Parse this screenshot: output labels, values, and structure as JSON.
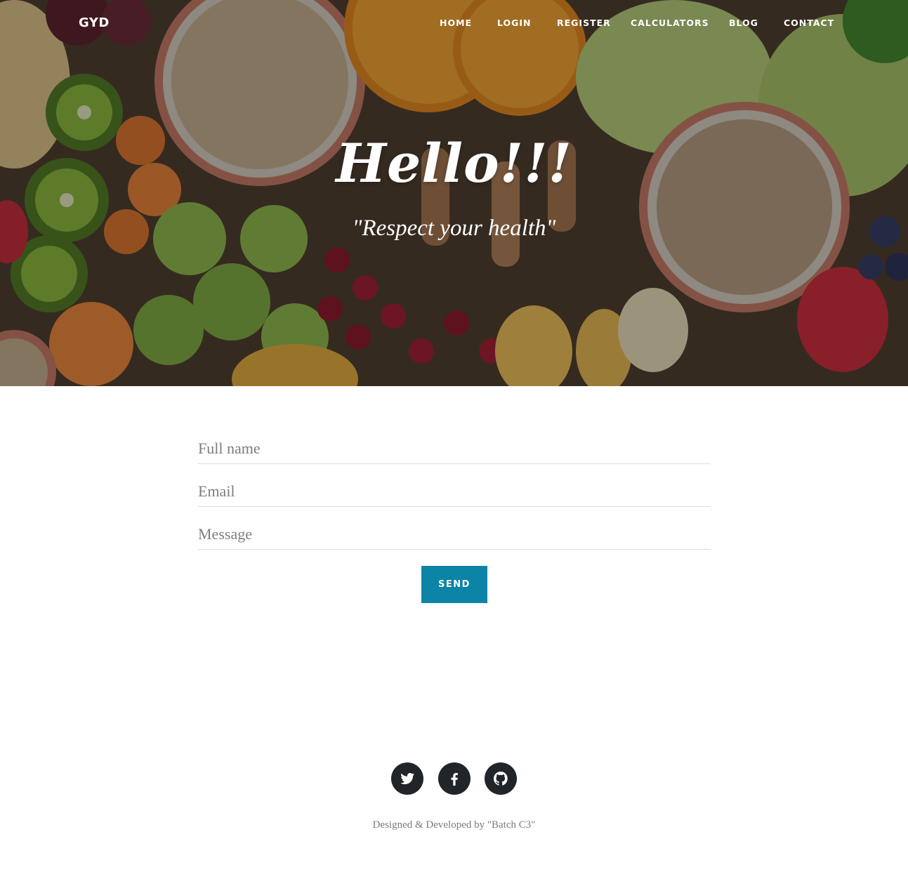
{
  "nav": {
    "brand": "GYD",
    "items": [
      {
        "label": "HOME"
      },
      {
        "label": "LOGIN"
      },
      {
        "label": "REGISTER"
      },
      {
        "label": "CALCULATORS"
      },
      {
        "label": "BLOG"
      },
      {
        "label": "CONTACT"
      }
    ]
  },
  "hero": {
    "title": "Hello!!!",
    "subtitle": "\"Respect your health\"",
    "background_icon": "healthy-food-photo"
  },
  "form": {
    "name_placeholder": "Full name",
    "email_placeholder": "Email",
    "message_placeholder": "Message",
    "send_label": "SEND"
  },
  "footer": {
    "social": [
      {
        "icon": "twitter-icon"
      },
      {
        "icon": "facebook-icon"
      },
      {
        "icon": "github-icon"
      }
    ],
    "credit": "Designed & Developed by \"Batch C3\""
  },
  "colors": {
    "accent": "#0b84a5",
    "social_bg": "#212529",
    "text_muted": "#7b7b7b"
  }
}
